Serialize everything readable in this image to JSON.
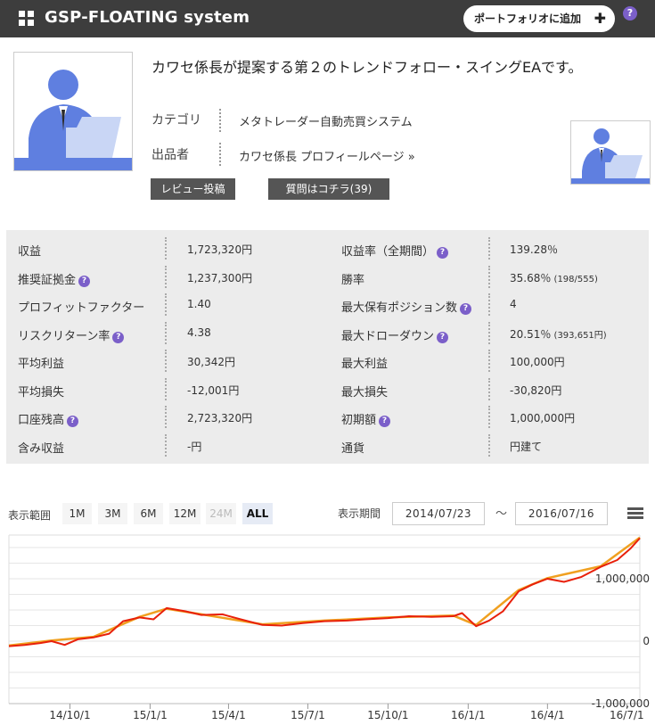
{
  "header": {
    "title": "GSP-FLOATING system",
    "portfolio_button": "ポートフォリオに追加",
    "help": "?"
  },
  "profile": {
    "description": "カワセ係長が提案する第２のトレンドフォロー・スイングEAです。",
    "category_label": "カテゴリ",
    "category_value": "メタトレーダー自動売買システム",
    "seller_label": "出品者",
    "seller_value": "カワセ係長 プロフィールページ »",
    "review_button": "レビュー投稿",
    "question_button": "質問はコチラ(39)"
  },
  "stats": {
    "left": [
      {
        "label": "収益",
        "value": "1,723,320円",
        "help": false
      },
      {
        "label": "推奨証拠金",
        "value": "1,237,300円",
        "help": true
      },
      {
        "label": "プロフィットファクター",
        "value": "1.40",
        "help": false
      },
      {
        "label": "リスクリターン率",
        "value": "4.38",
        "help": true
      },
      {
        "label": "平均利益",
        "value": "30,342円",
        "help": false
      },
      {
        "label": "平均損失",
        "value": "-12,001円",
        "help": false
      },
      {
        "label": "口座残高",
        "value": "2,723,320円",
        "help": true
      },
      {
        "label": "含み収益",
        "value": "-円",
        "help": false
      }
    ],
    "right": [
      {
        "label": "収益率（全期間）",
        "value": "139.28％",
        "sub": "",
        "help": true
      },
      {
        "label": "勝率",
        "value": "35.68％",
        "sub": "(198/555)",
        "help": false
      },
      {
        "label": "最大保有ポジション数",
        "value": "4",
        "sub": "",
        "help": true
      },
      {
        "label": "最大ドローダウン",
        "value": "20.51％",
        "sub": "(393,651円)",
        "help": true
      },
      {
        "label": "最大利益",
        "value": "100,000円",
        "sub": "",
        "help": false
      },
      {
        "label": "最大損失",
        "value": "-30,820円",
        "sub": "",
        "help": false
      },
      {
        "label": "初期額",
        "value": "1,000,000円",
        "sub": "",
        "help": true
      },
      {
        "label": "通貨",
        "value": "円建て",
        "sub": "",
        "help": false
      }
    ]
  },
  "controls": {
    "range_label": "表示範囲",
    "ranges": [
      "1M",
      "3M",
      "6M",
      "12M",
      "24M",
      "ALL"
    ],
    "disabled_range": "24M",
    "active_range": "ALL",
    "period_label": "表示期間",
    "date_from": "2014/07/23",
    "tilde": "〜",
    "date_to": "2016/07/16"
  },
  "chart_data": {
    "type": "line",
    "y_ticks": [
      "1,000,000",
      "0",
      "-1,000,000"
    ],
    "y_tick_values": [
      1000000,
      0,
      -1000000
    ],
    "ylim": [
      -1000000,
      1700000
    ],
    "x_ticks": [
      "14/10/1",
      "15/1/1",
      "15/4/1",
      "15/7/1",
      "15/10/1",
      "16/1/1",
      "16/4/1",
      "16/7/1"
    ],
    "x_tick_dates": [
      "2014-10-01",
      "2015-01-01",
      "2015-04-01",
      "2015-07-01",
      "2015-10-01",
      "2016-01-01",
      "2016-04-01",
      "2016-07-01"
    ],
    "x_range": [
      "2014-07-23",
      "2016-07-16"
    ],
    "series": [
      {
        "color": "#e8200a",
        "x": [
          "2014-07-23",
          "2014-08-10",
          "2014-08-28",
          "2014-09-10",
          "2014-09-25",
          "2014-10-10",
          "2014-10-28",
          "2014-11-15",
          "2014-12-01",
          "2014-12-20",
          "2015-01-05",
          "2015-01-20",
          "2015-02-10",
          "2015-03-01",
          "2015-03-25",
          "2015-04-15",
          "2015-05-10",
          "2015-06-01",
          "2015-06-25",
          "2015-07-20",
          "2015-08-15",
          "2015-09-05",
          "2015-10-01",
          "2015-10-25",
          "2015-11-20",
          "2015-12-15",
          "2015-12-25",
          "2016-01-10",
          "2016-01-25",
          "2016-02-10",
          "2016-02-28",
          "2016-03-15",
          "2016-04-01",
          "2016-04-20",
          "2016-05-10",
          "2016-06-01",
          "2016-06-20",
          "2016-07-05",
          "2016-07-16"
        ],
        "y": [
          -80000,
          -60000,
          -30000,
          0,
          -60000,
          30000,
          60000,
          120000,
          320000,
          380000,
          350000,
          530000,
          480000,
          420000,
          430000,
          350000,
          260000,
          250000,
          290000,
          320000,
          330000,
          350000,
          370000,
          400000,
          390000,
          400000,
          450000,
          240000,
          330000,
          480000,
          800000,
          910000,
          1000000,
          950000,
          1030000,
          1190000,
          1300000,
          1480000,
          1650000
        ]
      },
      {
        "color": "#f0a020",
        "x": [
          "2014-07-23",
          "2014-09-10",
          "2014-10-28",
          "2014-12-20",
          "2015-01-20",
          "2015-03-01",
          "2015-05-10",
          "2015-07-20",
          "2015-10-01",
          "2015-12-15",
          "2016-01-10",
          "2016-02-28",
          "2016-04-01",
          "2016-06-01",
          "2016-07-16"
        ],
        "y": [
          -70000,
          10000,
          70000,
          390000,
          520000,
          430000,
          270000,
          330000,
          380000,
          410000,
          260000,
          820000,
          1010000,
          1200000,
          1660000
        ]
      }
    ],
    "grid": true
  }
}
